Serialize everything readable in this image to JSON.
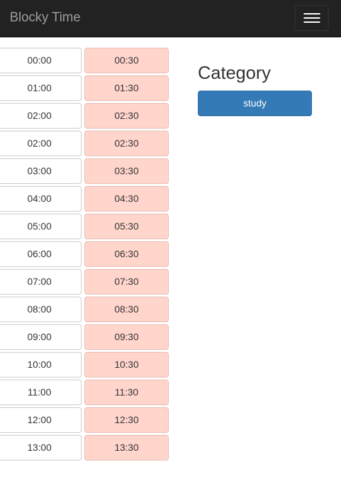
{
  "navbar": {
    "brand": "Blocky Time",
    "toggle_icon": "hamburger-menu-icon"
  },
  "timeslots": [
    {
      "full": "00:00",
      "half": "00:30"
    },
    {
      "full": "01:00",
      "half": "01:30"
    },
    {
      "full": "02:00",
      "half": "02:30"
    },
    {
      "full": "02:00",
      "half": "02:30"
    },
    {
      "full": "03:00",
      "half": "03:30"
    },
    {
      "full": "04:00",
      "half": "04:30"
    },
    {
      "full": "05:00",
      "half": "05:30"
    },
    {
      "full": "06:00",
      "half": "06:30"
    },
    {
      "full": "07:00",
      "half": "07:30"
    },
    {
      "full": "08:00",
      "half": "08:30"
    },
    {
      "full": "09:00",
      "half": "09:30"
    },
    {
      "full": "10:00",
      "half": "10:30"
    },
    {
      "full": "11:00",
      "half": "11:30"
    },
    {
      "full": "12:00",
      "half": "12:30"
    },
    {
      "full": "13:00",
      "half": "13:30"
    }
  ],
  "category": {
    "title": "Category",
    "items": [
      "study"
    ]
  },
  "colors": {
    "navbar_bg": "#222222",
    "half_slot_bg": "#ffd5cc",
    "primary_button": "#337ab7"
  }
}
